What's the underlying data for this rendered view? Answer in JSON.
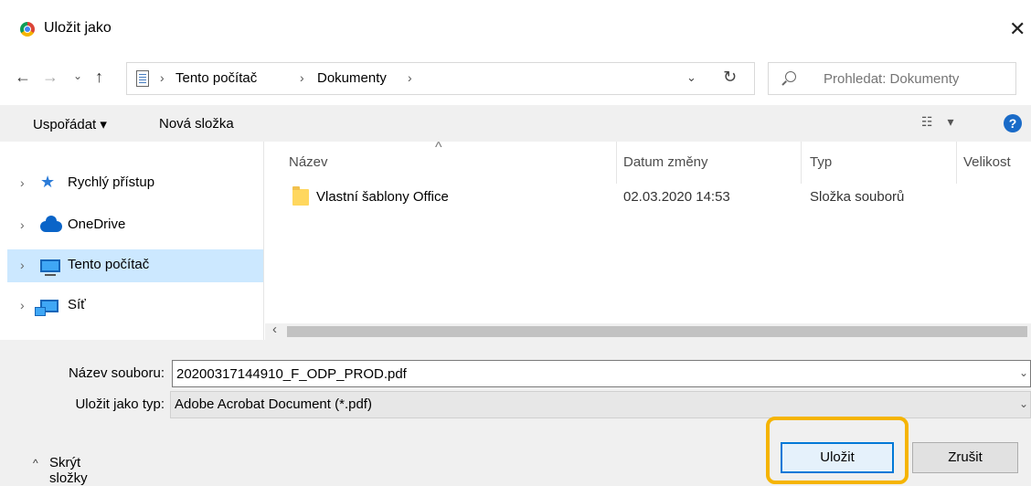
{
  "window": {
    "title": "Uložit jako",
    "close_glyph": "✕"
  },
  "nav": {
    "back": "←",
    "forward": "→",
    "history": "⌄",
    "up": "↑",
    "refresh": "↻"
  },
  "address": {
    "segments": [
      "Tento počítač",
      "Dokumenty"
    ],
    "separator": "›",
    "dropdown": "⌄"
  },
  "search": {
    "placeholder": "Prohledat: Dokumenty"
  },
  "toolbar": {
    "organize_label": "Uspořádat ▾",
    "new_folder_label": "Nová složka",
    "view_glyph": "☷ ▾",
    "help_glyph": "?"
  },
  "sidebar": {
    "items": [
      {
        "label": "Rychlý přístup",
        "icon": "star-icon",
        "selected": false
      },
      {
        "label": "OneDrive",
        "icon": "cloud-icon",
        "selected": false
      },
      {
        "label": "Tento počítač",
        "icon": "pc-icon",
        "selected": true
      },
      {
        "label": "Síť",
        "icon": "network-icon",
        "selected": false
      }
    ],
    "chevron": "›"
  },
  "filelist": {
    "columns": [
      "Název",
      "Datum změny",
      "Typ",
      "Velikost"
    ],
    "sort_indicator": "^",
    "rows": [
      {
        "name": "Vlastní šablony Office",
        "date": "02.03.2020 14:53",
        "type": "Složka souborů",
        "icon": "folder-icon"
      }
    ],
    "scroll_left": "‹"
  },
  "form": {
    "filename_label": "Název souboru:",
    "filename_value": "20200317144910_F_ODP_PROD.pdf",
    "filetype_label": "Uložit jako typ:",
    "filetype_value": "Adobe Acrobat Document (*.pdf)",
    "dropdown_glyph": "⌄"
  },
  "footer": {
    "hide_folders_chevron": "^",
    "hide_folders_label": "Skrýt složky",
    "save_label": "Uložit",
    "cancel_label": "Zrušit"
  },
  "colors": {
    "accent": "#0078d7",
    "highlight": "#f5b400",
    "selected_nav": "#cce8ff",
    "panel_bg": "#f0f0f0"
  }
}
